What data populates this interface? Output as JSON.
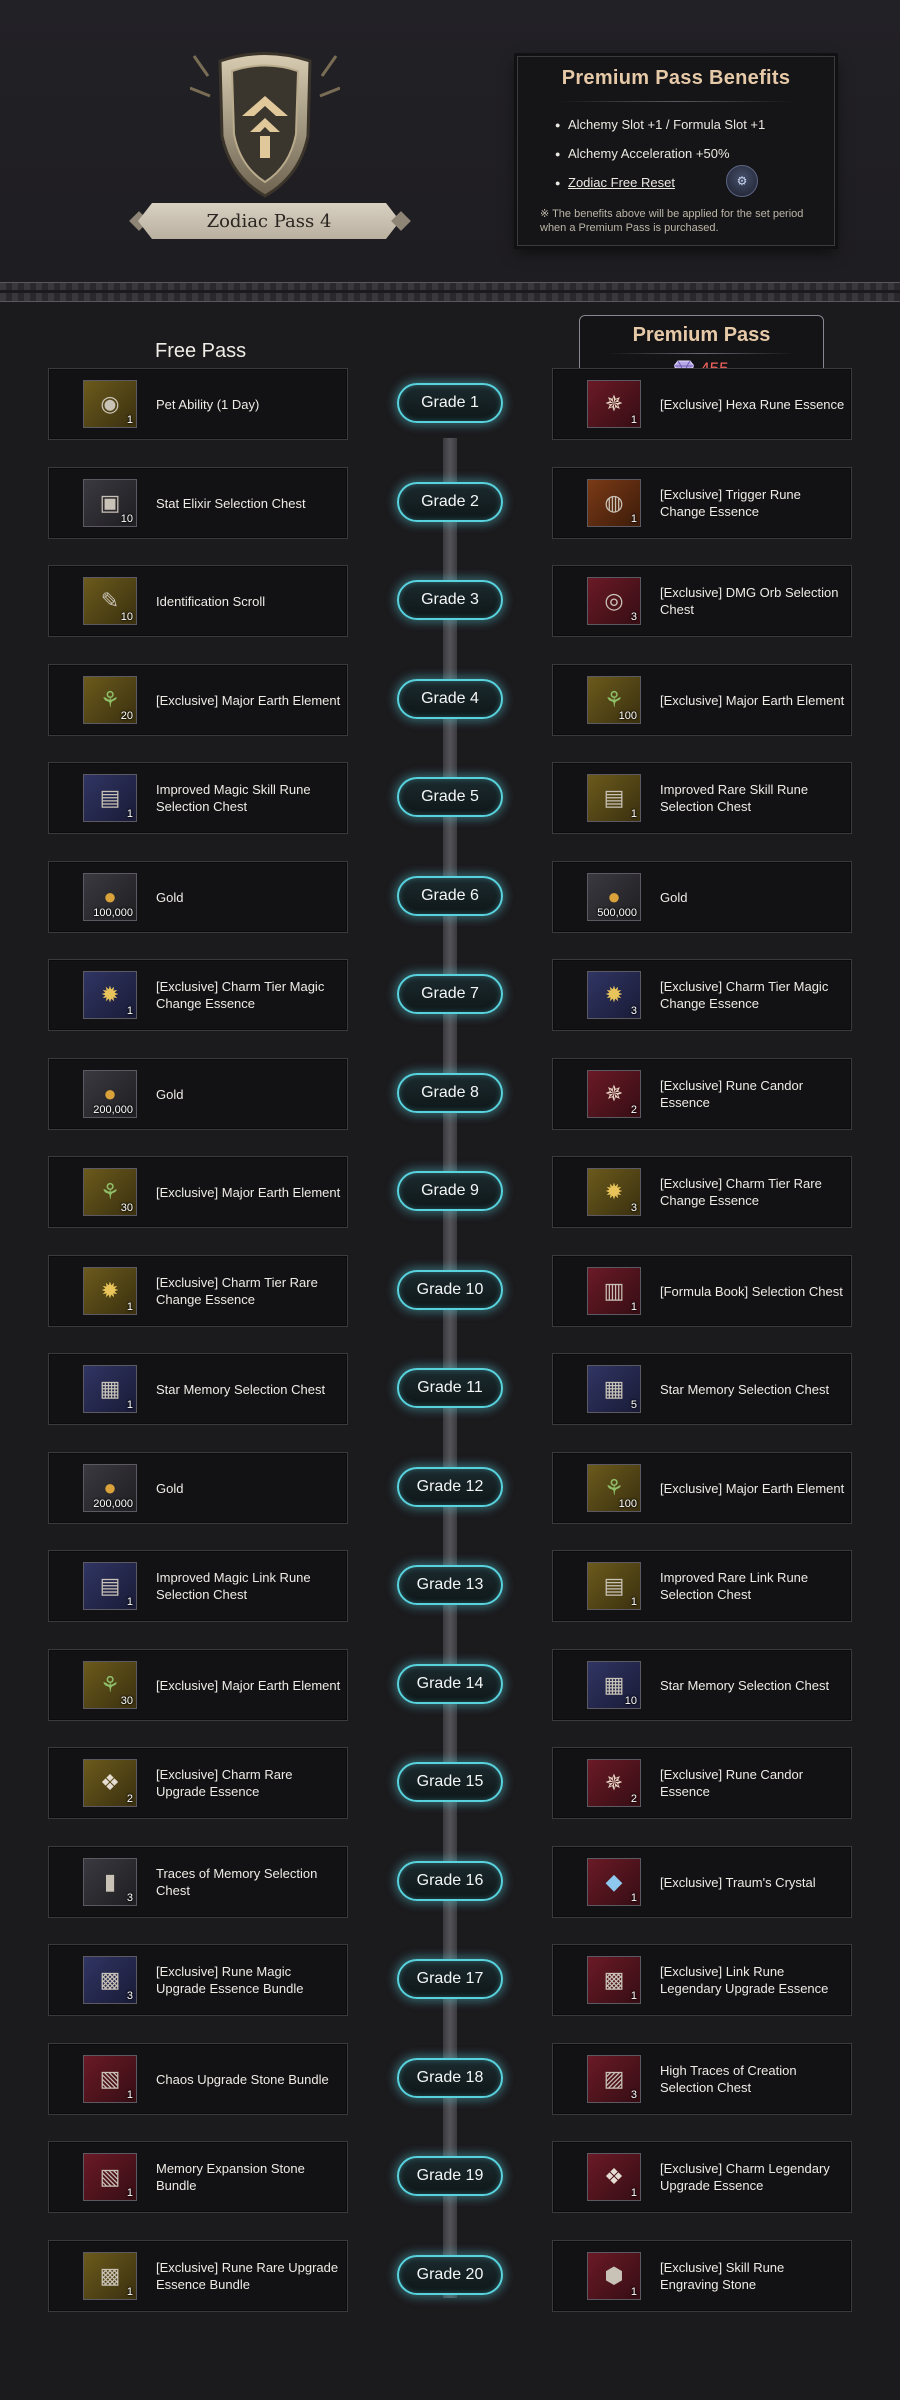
{
  "pass": {
    "title": "Zodiac Pass 4"
  },
  "benefits": {
    "title": "Premium Pass Benefits",
    "items": [
      "Alchemy Slot +1 / Formula Slot +1",
      "Alchemy Acceleration +50%",
      "Zodiac Free Reset"
    ],
    "note": "※ The benefits above will be applied for the set period when a Premium Pass is purchased."
  },
  "free": {
    "label": "Free Pass"
  },
  "premium": {
    "label": "Premium Pass",
    "price": "455"
  },
  "rows": [
    {
      "grade": "Grade 1",
      "free": {
        "name": "Pet Ability (1 Day)",
        "qty": "1",
        "color": "yellow",
        "icon": "pet-medal-icon"
      },
      "premium": {
        "name": "[Exclusive] Hexa Rune Essence",
        "qty": "1",
        "color": "red",
        "icon": "rune-essence-icon"
      }
    },
    {
      "grade": "Grade 2",
      "free": {
        "name": "Stat Elixir Selection Chest",
        "qty": "10",
        "color": "gray",
        "icon": "elixir-chest-icon"
      },
      "premium": {
        "name": "[Exclusive] Trigger Rune Change Essence",
        "qty": "1",
        "color": "orange",
        "icon": "trigger-rune-icon"
      }
    },
    {
      "grade": "Grade 3",
      "free": {
        "name": "Identification Scroll",
        "qty": "10",
        "color": "yellow",
        "icon": "scroll-icon"
      },
      "premium": {
        "name": "[Exclusive] DMG Orb Selection Chest",
        "qty": "3",
        "color": "red",
        "icon": "orb-chest-icon"
      }
    },
    {
      "grade": "Grade 4",
      "free": {
        "name": "[Exclusive] Major Earth Element",
        "qty": "20",
        "color": "yellow",
        "icon": "earth-element-icon"
      },
      "premium": {
        "name": "[Exclusive] Major Earth Element",
        "qty": "100",
        "color": "yellow",
        "icon": "earth-element-icon"
      }
    },
    {
      "grade": "Grade 5",
      "free": {
        "name": "Improved Magic Skill Rune Selection Chest",
        "qty": "1",
        "color": "blue",
        "icon": "rune-chest-icon"
      },
      "premium": {
        "name": "Improved Rare Skill Rune Selection Chest",
        "qty": "1",
        "color": "yellow",
        "icon": "rune-chest-icon"
      }
    },
    {
      "grade": "Grade 6",
      "free": {
        "name": "Gold",
        "qty": "100,000",
        "color": "gray",
        "icon": "gold-coin-icon"
      },
      "premium": {
        "name": "Gold",
        "qty": "500,000",
        "color": "gray",
        "icon": "gold-coin-icon"
      }
    },
    {
      "grade": "Grade 7",
      "free": {
        "name": "[Exclusive] Charm Tier Magic Change Essence",
        "qty": "1",
        "color": "blue",
        "icon": "charm-essence-icon"
      },
      "premium": {
        "name": "[Exclusive] Charm Tier Magic Change Essence",
        "qty": "3",
        "color": "blue",
        "icon": "charm-essence-icon"
      }
    },
    {
      "grade": "Grade 8",
      "free": {
        "name": "Gold",
        "qty": "200,000",
        "color": "gray",
        "icon": "gold-coin-icon"
      },
      "premium": {
        "name": "[Exclusive] Rune Candor Essence",
        "qty": "2",
        "color": "red",
        "icon": "rune-essence-icon"
      }
    },
    {
      "grade": "Grade 9",
      "free": {
        "name": "[Exclusive] Major Earth Element",
        "qty": "30",
        "color": "yellow",
        "icon": "earth-element-icon"
      },
      "premium": {
        "name": "[Exclusive] Charm Tier Rare Change Essence",
        "qty": "3",
        "color": "yellow",
        "icon": "charm-essence-icon"
      }
    },
    {
      "grade": "Grade 10",
      "free": {
        "name": "[Exclusive] Charm Tier Rare Change Essence",
        "qty": "1",
        "color": "yellow",
        "icon": "charm-essence-icon"
      },
      "premium": {
        "name": "[Formula Book] Selection Chest",
        "qty": "1",
        "color": "red",
        "icon": "formula-chest-icon"
      }
    },
    {
      "grade": "Grade 11",
      "free": {
        "name": "Star Memory Selection Chest",
        "qty": "1",
        "color": "blue",
        "icon": "memory-chest-icon"
      },
      "premium": {
        "name": "Star Memory Selection Chest",
        "qty": "5",
        "color": "blue",
        "icon": "memory-chest-icon"
      }
    },
    {
      "grade": "Grade 12",
      "free": {
        "name": "Gold",
        "qty": "200,000",
        "color": "gray",
        "icon": "gold-coin-icon"
      },
      "premium": {
        "name": "[Exclusive] Major Earth Element",
        "qty": "100",
        "color": "yellow",
        "icon": "earth-element-icon"
      }
    },
    {
      "grade": "Grade 13",
      "free": {
        "name": "Improved Magic Link Rune Selection Chest",
        "qty": "1",
        "color": "blue",
        "icon": "rune-chest-icon"
      },
      "premium": {
        "name": "Improved Rare Link Rune Selection Chest",
        "qty": "1",
        "color": "yellow",
        "icon": "rune-chest-icon"
      }
    },
    {
      "grade": "Grade 14",
      "free": {
        "name": "[Exclusive] Major Earth Element",
        "qty": "30",
        "color": "yellow",
        "icon": "earth-element-icon"
      },
      "premium": {
        "name": "Star Memory Selection Chest",
        "qty": "10",
        "color": "blue",
        "icon": "memory-chest-icon"
      }
    },
    {
      "grade": "Grade 15",
      "free": {
        "name": "[Exclusive] Charm Rare Upgrade Essence",
        "qty": "2",
        "color": "yellow",
        "icon": "charm-upgrade-icon"
      },
      "premium": {
        "name": "[Exclusive] Rune Candor Essence",
        "qty": "2",
        "color": "red",
        "icon": "rune-essence-icon"
      }
    },
    {
      "grade": "Grade 16",
      "free": {
        "name": "Traces of Memory Selection Chest",
        "qty": "3",
        "color": "gray",
        "icon": "traces-chest-icon"
      },
      "premium": {
        "name": "[Exclusive] Traum's Crystal",
        "qty": "1",
        "color": "red",
        "icon": "crystal-icon"
      }
    },
    {
      "grade": "Grade 17",
      "free": {
        "name": "[Exclusive] Rune Magic Upgrade Essence Bundle",
        "qty": "3",
        "color": "blue",
        "icon": "essence-bundle-icon"
      },
      "premium": {
        "name": "[Exclusive] Link Rune Legendary Upgrade Essence",
        "qty": "1",
        "color": "red",
        "icon": "essence-bundle-icon"
      }
    },
    {
      "grade": "Grade 18",
      "free": {
        "name": "Chaos Upgrade Stone Bundle",
        "qty": "1",
        "color": "red",
        "icon": "stone-bundle-icon"
      },
      "premium": {
        "name": "High Traces of Creation Selection Chest",
        "qty": "3",
        "color": "red",
        "icon": "creation-chest-icon"
      }
    },
    {
      "grade": "Grade 19",
      "free": {
        "name": "Memory Expansion Stone Bundle",
        "qty": "1",
        "color": "red",
        "icon": "stone-bundle-icon"
      },
      "premium": {
        "name": "[Exclusive] Charm Legendary Upgrade Essence",
        "qty": "1",
        "color": "red",
        "icon": "charm-upgrade-icon"
      }
    },
    {
      "grade": "Grade 20",
      "free": {
        "name": "[Exclusive] Rune Rare Upgrade Essence Bundle",
        "qty": "1",
        "color": "yellow",
        "icon": "essence-bundle-icon"
      },
      "premium": {
        "name": "[Exclusive] Skill Rune Engraving Stone",
        "qty": "1",
        "color": "red",
        "icon": "engraving-stone-icon"
      }
    }
  ]
}
